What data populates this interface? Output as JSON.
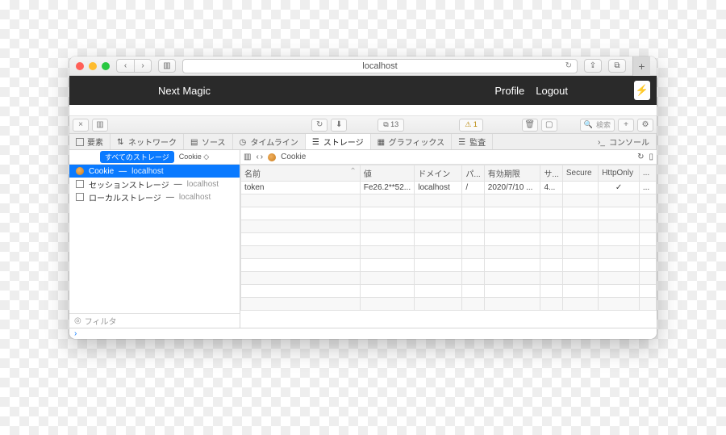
{
  "browser": {
    "url": "localhost",
    "nav_back": "‹",
    "nav_fwd": "›",
    "sidebar_btn": "▥",
    "share": "⇪",
    "tabs_btn": "⧉",
    "new_tab": "+",
    "reload": "↻"
  },
  "page": {
    "brand": "Next Magic",
    "nav": {
      "profile": "Profile",
      "logout": "Logout"
    },
    "bolt": "⚡"
  },
  "devtools": {
    "toolbar": {
      "close": "×",
      "panes": "▥",
      "reload": "↻",
      "download": "⬇",
      "count": "⧉ 13",
      "warn": "⚠ 1",
      "trash": "🗑",
      "box": "▢",
      "search_label": "検索",
      "plus": "+",
      "gear": "⚙"
    },
    "tabs": {
      "elements": "要素",
      "network": "ネットワーク",
      "sources": "ソース",
      "timeline": "タイムライン",
      "storage": "ストレージ",
      "graphics": "グラフィックス",
      "audit": "監査",
      "console": "コンソール"
    },
    "sidebar": {
      "chip": "すべてのストレージ",
      "cookie_label": "Cookie",
      "items": [
        {
          "icon": "cookie",
          "label": "Cookie",
          "host": "localhost",
          "selected": true
        },
        {
          "icon": "grid",
          "label": "セッションストレージ",
          "host": "localhost",
          "selected": false
        },
        {
          "icon": "grid",
          "label": "ローカルストレージ",
          "host": "localhost",
          "selected": false
        }
      ],
      "filter_label": "フィルタ"
    },
    "main": {
      "breadcrumb": "Cookie",
      "panel": "▥",
      "nav_back": "‹",
      "nav_fwd": "›",
      "refresh": "↻",
      "sidepane": "▯"
    },
    "table": {
      "headers": {
        "name": "名前",
        "value": "値",
        "domain": "ドメイン",
        "path": "パ...",
        "expires": "有効期限",
        "size": "サ...",
        "secure": "Secure",
        "httponly": "HttpOnly",
        "more": "..."
      },
      "rows": [
        {
          "name": "token",
          "value": "Fe26.2**52...",
          "domain": "localhost",
          "path": "/",
          "expires": "2020/7/10 ...",
          "size": "4...",
          "secure": "",
          "httponly": "✓",
          "more": "..."
        }
      ]
    },
    "console_prompt": "›"
  }
}
